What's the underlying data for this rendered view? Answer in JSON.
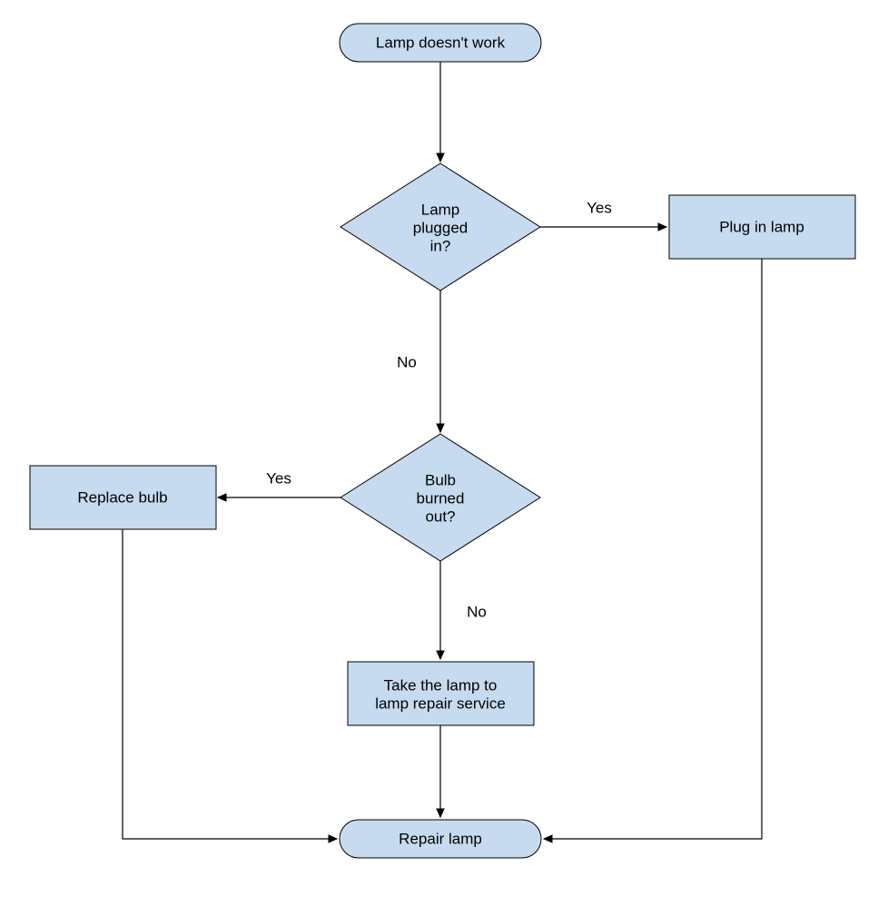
{
  "nodes": {
    "start": {
      "label": "Lamp doesn't work"
    },
    "plugged": {
      "line1": "Lamp",
      "line2": "plugged",
      "line3": "in?"
    },
    "plugin": {
      "label": "Plug in lamp"
    },
    "burned": {
      "line1": "Bulb",
      "line2": "burned",
      "line3": "out?"
    },
    "replace": {
      "label": "Replace bulb"
    },
    "repair_service": {
      "line1": "Take the lamp to",
      "line2": "lamp repair service"
    },
    "end": {
      "label": "Repair lamp"
    }
  },
  "edges": {
    "plugged_yes": "Yes",
    "plugged_no": "No",
    "burned_yes": "Yes",
    "burned_no": "No"
  },
  "chart_data": {
    "type": "flowchart",
    "title": "",
    "nodes": [
      {
        "id": "start",
        "type": "terminal",
        "label": "Lamp doesn't work"
      },
      {
        "id": "plugged",
        "type": "decision",
        "label": "Lamp plugged in?"
      },
      {
        "id": "plugin",
        "type": "process",
        "label": "Plug in lamp"
      },
      {
        "id": "burned",
        "type": "decision",
        "label": "Bulb burned out?"
      },
      {
        "id": "replace",
        "type": "process",
        "label": "Replace bulb"
      },
      {
        "id": "repair_service",
        "type": "process",
        "label": "Take the lamp to lamp repair service"
      },
      {
        "id": "end",
        "type": "terminal",
        "label": "Repair lamp"
      }
    ],
    "edges": [
      {
        "from": "start",
        "to": "plugged",
        "label": ""
      },
      {
        "from": "plugged",
        "to": "plugin",
        "label": "Yes"
      },
      {
        "from": "plugged",
        "to": "burned",
        "label": "No"
      },
      {
        "from": "burned",
        "to": "replace",
        "label": "Yes"
      },
      {
        "from": "burned",
        "to": "repair_service",
        "label": "No"
      },
      {
        "from": "repair_service",
        "to": "end",
        "label": ""
      },
      {
        "from": "replace",
        "to": "end",
        "label": ""
      },
      {
        "from": "plugin",
        "to": "end",
        "label": ""
      }
    ]
  }
}
